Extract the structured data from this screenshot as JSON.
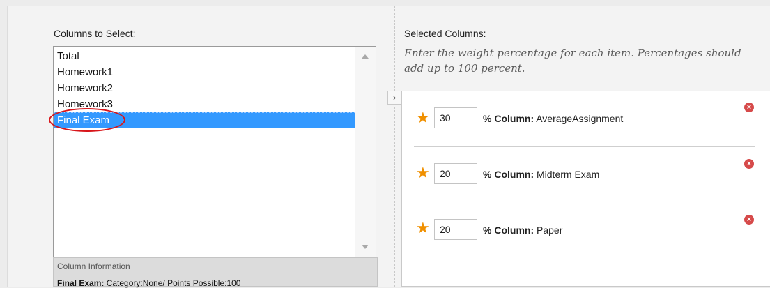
{
  "left": {
    "heading": "Columns to Select:",
    "items": [
      "Total",
      "Homework1",
      "Homework2",
      "Homework3",
      "Final Exam"
    ],
    "selected_index": 4,
    "info_title": "Column Information",
    "info_name": "Final Exam:",
    "info_detail": " Category:None/ Points Possible:100"
  },
  "right": {
    "heading": "Selected Columns:",
    "instructions": "Enter the weight percentage for each item. Percentages should add up to 100 percent.",
    "column_prefix": "% Column:",
    "rows": [
      {
        "weight": "30",
        "column": " AverageAssignment"
      },
      {
        "weight": "20",
        "column": " Midterm Exam"
      },
      {
        "weight": "20",
        "column": " Paper"
      }
    ]
  },
  "icons": {
    "star": "required-star-icon",
    "remove": "remove-icon",
    "expand": "chevron-right-icon"
  },
  "colors": {
    "selection": "#3399ff",
    "required_star": "#f09000",
    "remove": "#d64a4a",
    "annotation_circle": "#d8161b"
  }
}
